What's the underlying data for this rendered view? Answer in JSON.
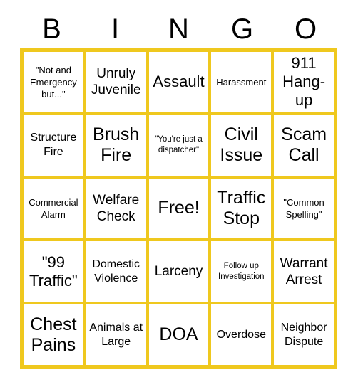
{
  "card": {
    "title": "BINGO",
    "header_letters": [
      "B",
      "I",
      "N",
      "G",
      "O"
    ],
    "accent_color": "#EFC81E",
    "text_color": "#000000",
    "background_color": "#FFFFFF",
    "grid_size": "5x5",
    "free_space_index": 12,
    "cells": [
      {
        "text": "\"Not and Emergency but...\"",
        "size": "sm"
      },
      {
        "text": "Unruly Juvenile",
        "size": "lg"
      },
      {
        "text": "Assault",
        "size": "xl"
      },
      {
        "text": "Harassment",
        "size": "sm"
      },
      {
        "text": "911 Hang-up",
        "size": "xl"
      },
      {
        "text": "Structure Fire",
        "size": "md"
      },
      {
        "text": "Brush Fire",
        "size": "xxl"
      },
      {
        "text": "\"You're just a dispatcher\"",
        "size": "xs"
      },
      {
        "text": "Civil Issue",
        "size": "xxl"
      },
      {
        "text": "Scam Call",
        "size": "xxl"
      },
      {
        "text": "Commercial Alarm",
        "size": "sm"
      },
      {
        "text": "Welfare Check",
        "size": "lg"
      },
      {
        "text": "Free!",
        "size": "xxl"
      },
      {
        "text": "Traffic Stop",
        "size": "xxl"
      },
      {
        "text": "\"Common Spelling\"",
        "size": "sm"
      },
      {
        "text": "\"99 Traffic\"",
        "size": "xl"
      },
      {
        "text": "Domestic Violence",
        "size": "md"
      },
      {
        "text": "Larceny",
        "size": "lg"
      },
      {
        "text": "Follow up Investigation",
        "size": "xs"
      },
      {
        "text": "Warrant Arrest",
        "size": "lg"
      },
      {
        "text": "Chest Pains",
        "size": "xxl"
      },
      {
        "text": "Animals at Large",
        "size": "md"
      },
      {
        "text": "DOA",
        "size": "xxl"
      },
      {
        "text": "Overdose",
        "size": "md"
      },
      {
        "text": "Neighbor Dispute",
        "size": "md"
      }
    ]
  }
}
